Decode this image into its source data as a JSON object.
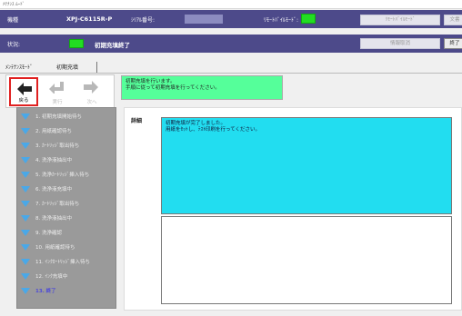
{
  "window": {
    "title": "ﾒﾃﾅﾝｽ ﾑｰﾄﾞ"
  },
  "header": {
    "model_label": "機種",
    "model_value": "XPJ-C6115R-P",
    "serial_label": "ｼﾘｱﾙ番号:",
    "remote_label": "ﾘﾓｰﾄﾊﾞｲﾙﾓｰﾄﾞ:",
    "status_label": "状況:",
    "status_value": "初期充填終了",
    "indicator_color": "#22dd22",
    "btn_remote_mode": "ﾘﾓｰﾄﾊﾞｲﾙﾓｰﾄﾞ",
    "btn_cut1": "文書",
    "btn_info": "情報取消",
    "btn_cut2": "終了"
  },
  "tabs": {
    "first": "ﾒﾝﾃﾅﾝｽﾓｰﾄﾞ",
    "second": "初期充填"
  },
  "toolbar": {
    "back": "戻る",
    "run": "実行",
    "next": "次へ"
  },
  "message": {
    "line1": "初期充填を行います。",
    "line2": "手順に従って初期充填を行ってください。"
  },
  "steps": [
    "1. 初期充填開始待ち",
    "2. 用紙確認待ち",
    "3. ｶｰﾄﾘｯｼﾞ取出待ち",
    "4. 洗浄液抽出中",
    "5. 洗浄ｶｰﾄﾘｯｼﾞ挿入待ち",
    "6. 洗浄液充填中",
    "7. ｶｰﾄﾘｯｼﾞ取出待ち",
    "8. 洗浄液抽出中",
    "9. 洗浄確認",
    "10. 用紙確認待ち",
    "11. ｲﾝｸｶｰﾄﾘｯｼﾞ挿入待ち",
    "12. ｲﾝｸ充填中",
    "13. 終了"
  ],
  "detail": {
    "label": "詳細",
    "line1": "初期充填が完了しました。",
    "line2": "用紙をｾｯﾄし、ﾃｽﾄ印刷を行ってください。"
  },
  "colors": {
    "header": "#4d4a8a",
    "message": "#55ff9a",
    "detail": "#22ddf0",
    "back_border": "#e02020"
  }
}
